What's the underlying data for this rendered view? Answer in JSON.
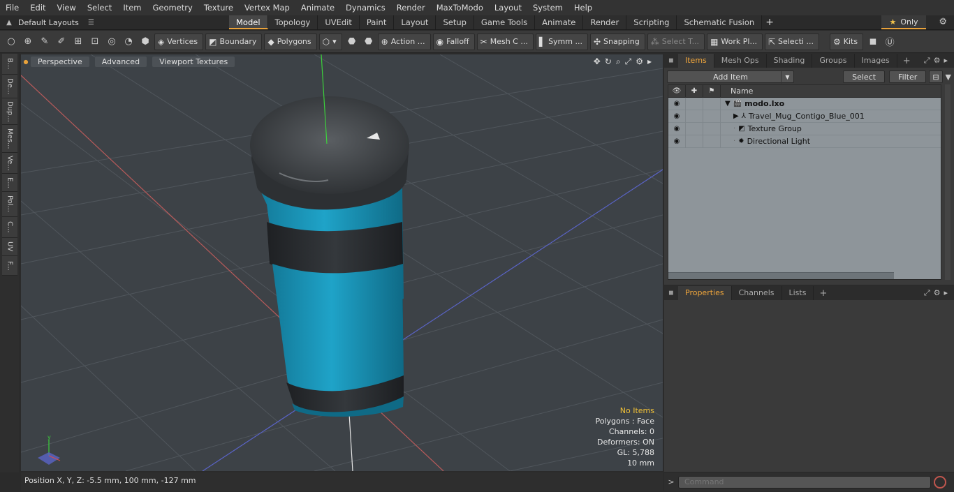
{
  "menu": [
    "File",
    "Edit",
    "View",
    "Select",
    "Item",
    "Geometry",
    "Texture",
    "Vertex Map",
    "Animate",
    "Dynamics",
    "Render",
    "MaxToModo",
    "Layout",
    "System",
    "Help"
  ],
  "layout": {
    "selector": "Default Layouts",
    "tabs": [
      "Model",
      "Topology",
      "UVEdit",
      "Paint",
      "Layout",
      "Setup",
      "Game Tools",
      "Animate",
      "Render",
      "Scripting",
      "Schematic Fusion"
    ],
    "active_tab": "Model",
    "only_label": "Only"
  },
  "toolbar": {
    "vertices": "Vertices",
    "boundary": "Boundary",
    "polygons": "Polygons",
    "action": "Action",
    "falloff": "Falloff",
    "mesh": "Mesh C ...",
    "symm": "Symm ...",
    "snapping": "Snapping",
    "select_t": "Select T...",
    "work_plane": "Work Pl...",
    "selecti": "Selecti ...",
    "kits": "Kits"
  },
  "left_tabs": [
    "B...",
    "De...",
    "Dup...",
    "Mes...",
    "Ve...",
    "E...",
    "Pol...",
    "C...",
    "UV",
    "F..."
  ],
  "viewport": {
    "perspective": "Perspective",
    "advanced": "Advanced",
    "viewport_textures": "Viewport Textures",
    "info": {
      "no_items": "No Items",
      "polygons": "Polygons : Face",
      "channels": "Channels: 0",
      "deformers": "Deformers: ON",
      "gl": "GL: 5,788",
      "scale": "10 mm"
    },
    "colors": {
      "mug_blue": "#1b93b5",
      "mug_dark": "#2a2d30",
      "background": "#3d4247",
      "accent": "#e9a23b"
    }
  },
  "status": {
    "position": "Position X, Y, Z:   -5.5 mm, 100 mm, -127 mm"
  },
  "items_panel": {
    "tabs": [
      "Items",
      "Mesh Ops",
      "Shading",
      "Groups",
      "Images"
    ],
    "active_tab": "Items",
    "add_item": "Add Item",
    "select": "Select",
    "filter": "Filter",
    "column_name": "Name",
    "rows": [
      {
        "name": "modo.lxo",
        "icon": "scene-icon"
      },
      {
        "name": "Travel_Mug_Contigo_Blue_001",
        "icon": "mesh-icon"
      },
      {
        "name": "Texture Group",
        "icon": "texture-group-icon"
      },
      {
        "name": "Directional Light",
        "icon": "light-icon"
      }
    ]
  },
  "properties_panel": {
    "tabs": [
      "Properties",
      "Channels",
      "Lists"
    ],
    "active_tab": "Properties"
  },
  "command": {
    "placeholder": "Command"
  }
}
